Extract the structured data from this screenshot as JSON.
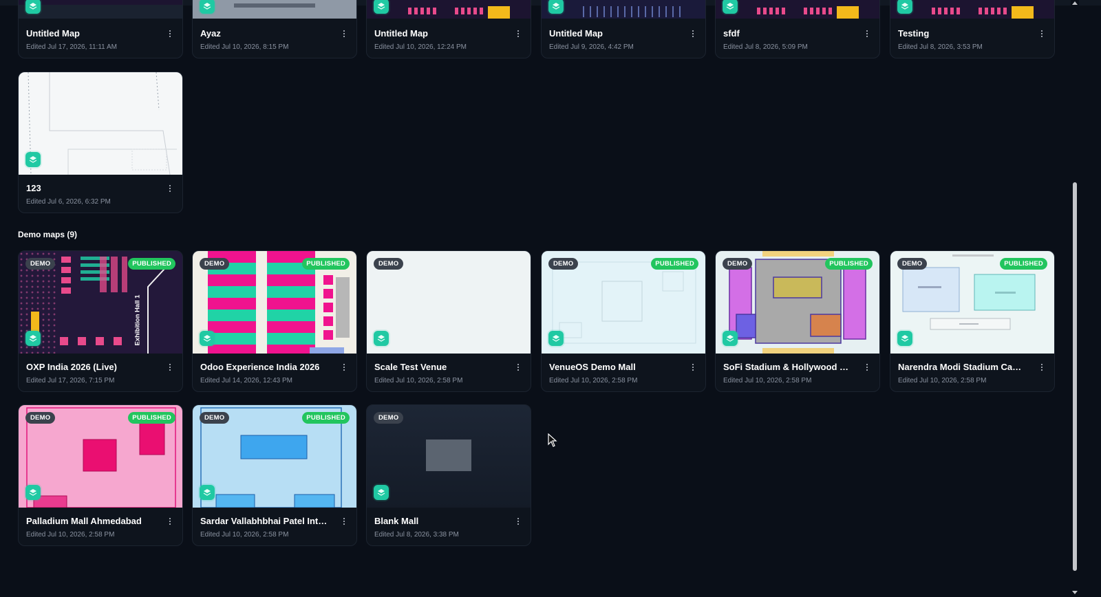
{
  "my_maps": [
    {
      "title": "Untitled Map",
      "edited": "Edited Jul 17, 2026, 11:11 AM"
    },
    {
      "title": "Ayaz",
      "edited": "Edited Jul 10, 2026, 8:15 PM"
    },
    {
      "title": "Untitled Map",
      "edited": "Edited Jul 10, 2026, 12:24 PM"
    },
    {
      "title": "Untitled Map",
      "edited": "Edited Jul 9, 2026, 4:42 PM"
    },
    {
      "title": "sfdf",
      "edited": "Edited Jul 8, 2026, 5:09 PM"
    },
    {
      "title": "Testing",
      "edited": "Edited Jul 8, 2026, 3:53 PM"
    },
    {
      "title": "123",
      "edited": "Edited Jul 6, 2026, 6:32 PM"
    }
  ],
  "demo_section": {
    "title": "Demo maps (9)"
  },
  "badges": {
    "demo": "DEMO",
    "published": "PUBLISHED"
  },
  "demo_maps": [
    {
      "title": "OXP India 2026 (Live)",
      "edited": "Edited Jul 17, 2026, 7:15 PM",
      "published": true,
      "thumb_label": "Exhibition Hall 1"
    },
    {
      "title": "Odoo Experience India 2026",
      "edited": "Edited Jul 14, 2026, 12:43 PM",
      "published": true
    },
    {
      "title": "Scale Test Venue",
      "edited": "Edited Jul 10, 2026, 2:58 PM",
      "published": false
    },
    {
      "title": "VenueOS Demo Mall",
      "edited": "Edited Jul 10, 2026, 2:58 PM",
      "published": true
    },
    {
      "title": "SoFi Stadium & Hollywood Park",
      "edited": "Edited Jul 10, 2026, 2:58 PM",
      "published": true
    },
    {
      "title": "Narendra Modi Stadium Campus",
      "edited": "Edited Jul 10, 2026, 2:58 PM",
      "published": true
    },
    {
      "title": "Palladium Mall Ahmedabad",
      "edited": "Edited Jul 10, 2026, 2:58 PM",
      "published": true
    },
    {
      "title": "Sardar Vallabhbhai Patel Intern...",
      "edited": "Edited Jul 10, 2026, 2:58 PM",
      "published": true
    },
    {
      "title": "Blank Mall",
      "edited": "Edited Jul 8, 2026, 3:38 PM",
      "published": false
    }
  ],
  "colors": {
    "background": "#0a0f18",
    "card": "#0e141d",
    "accent_teal": "#20c9a3",
    "published_green": "#22c55e",
    "demo_badge": "#3b424d"
  },
  "icons": {
    "layer_icon": "layers-icon",
    "menu_icon": "more-vertical-icon"
  }
}
